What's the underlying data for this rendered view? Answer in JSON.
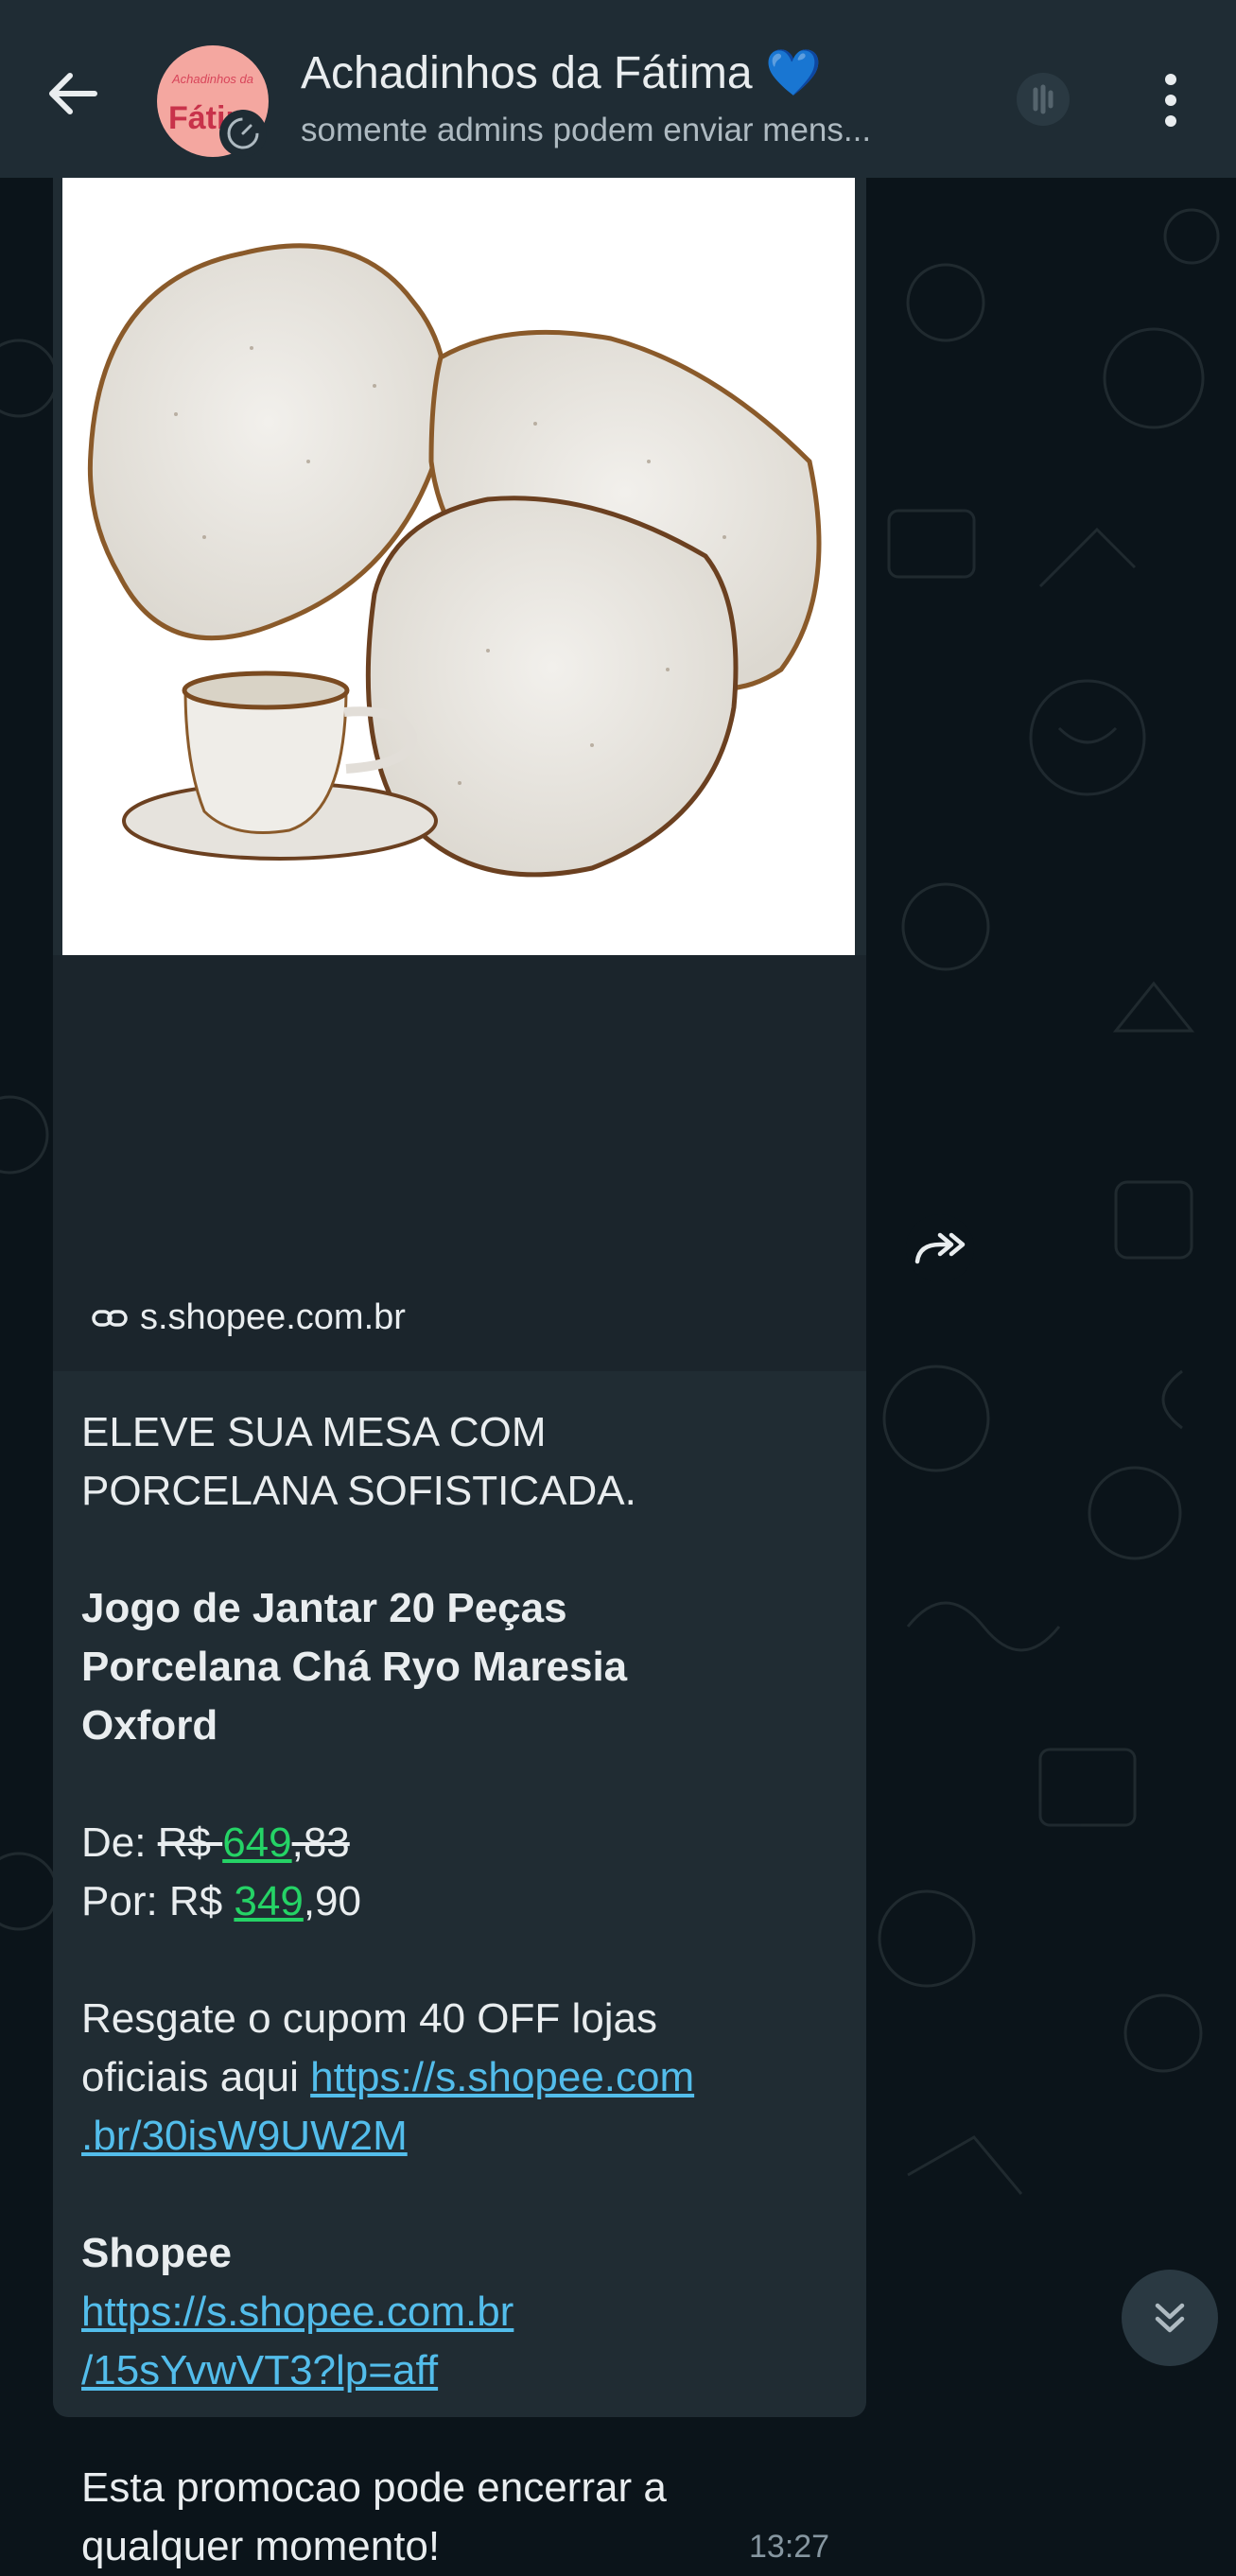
{
  "header": {
    "title": "Achadinhos da Fátima 💙",
    "subtitle": "somente admins podem enviar mens...",
    "avatar_text_top": "Achadinhos da",
    "avatar_text_main": "Fátim"
  },
  "message": {
    "link_domain": "s.shopee.com.br",
    "headline_1": "ELEVE SUA MESA COM",
    "headline_2": "PORCELANA SOFISTICADA.",
    "product_1": "Jogo de Jantar 20 Peças",
    "product_2": "Porcelana Chá Ryo Maresia",
    "product_3": "Oxford",
    "old_price_label": "De: ",
    "old_price_currency": "R$ ",
    "old_price_int": "649",
    "old_price_dec": ",83",
    "new_price_label": "Por: R$ ",
    "new_price_int": "349",
    "new_price_dec": ",90",
    "coupon_1": "Resgate o cupom 40 OFF lojas",
    "coupon_2_prefix": "oficiais aqui ",
    "coupon_link_1": "https://s.shopee.com",
    "coupon_link_2": ".br/30isW9UW2M",
    "store_name": "Shopee",
    "store_link_1": "https://s.shopee.com.br",
    "store_link_2": "/15sYvwVT3?lp=aff",
    "footer_1": "Esta promocao pode encerrar a",
    "footer_2": "qualquer momento!",
    "time": "13:27"
  },
  "icons": {
    "back": "arrow-left-icon",
    "call": "call-icon",
    "menu": "more-vertical-icon",
    "link": "link-icon",
    "forward": "forward-icon",
    "scroll_down": "double-chevron-down-icon"
  },
  "colors": {
    "header_bg": "#1f2c34",
    "bubble_bg": "#202c33",
    "link": "#53bdeb",
    "price_green": "#25d366"
  }
}
